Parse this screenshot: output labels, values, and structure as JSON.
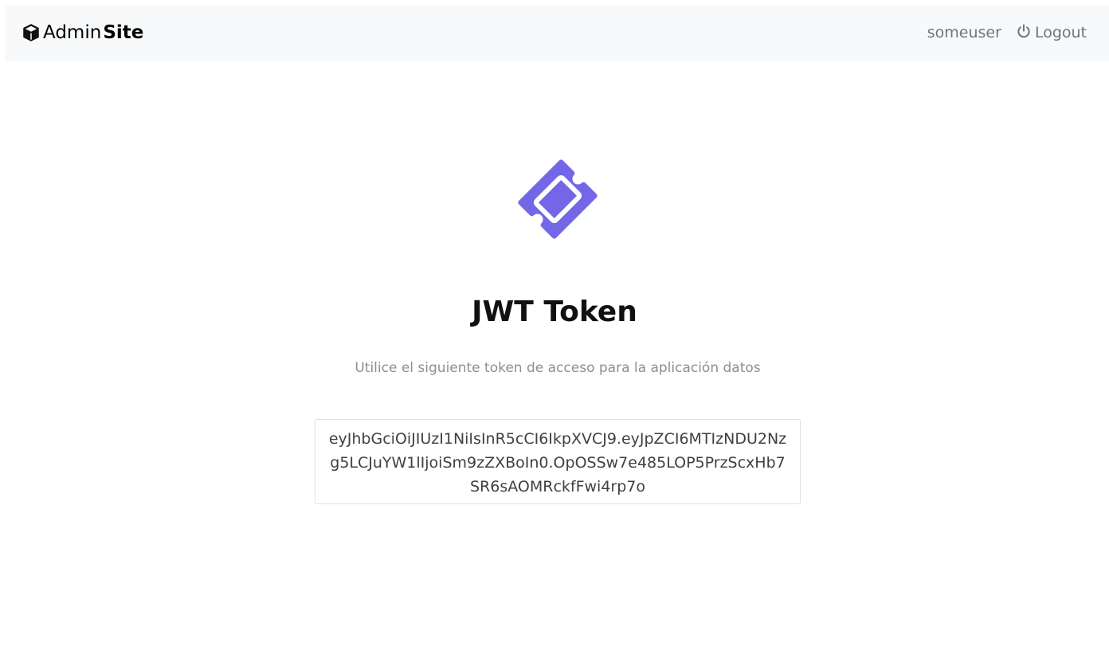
{
  "navbar": {
    "brand_light": "Admin",
    "brand_bold": "Site",
    "username": "someuser",
    "logout_label": "Logout"
  },
  "main": {
    "title": "JWT Token",
    "subtitle": "Utilice el siguiente token de acceso para la aplicación datos",
    "token": "eyJhbGciOiJIUzI1NiIsInR5cCI6IkpXVCJ9.eyJpZCI6MTIzNDU2Nzg5LCJuYW1lIjoiSm9zZXBoIn0.OpOSSw7e485LOP5PrzScxHb7SR6sAOMRckfFwi4rp7o"
  },
  "colors": {
    "accent": "#7367e8",
    "navbar_bg": "#f8f9fa",
    "muted_text": "#6c757d",
    "border": "#dee2e6"
  },
  "icons": {
    "brand": "cube-icon",
    "logout": "power-icon",
    "hero": "ticket-icon"
  }
}
